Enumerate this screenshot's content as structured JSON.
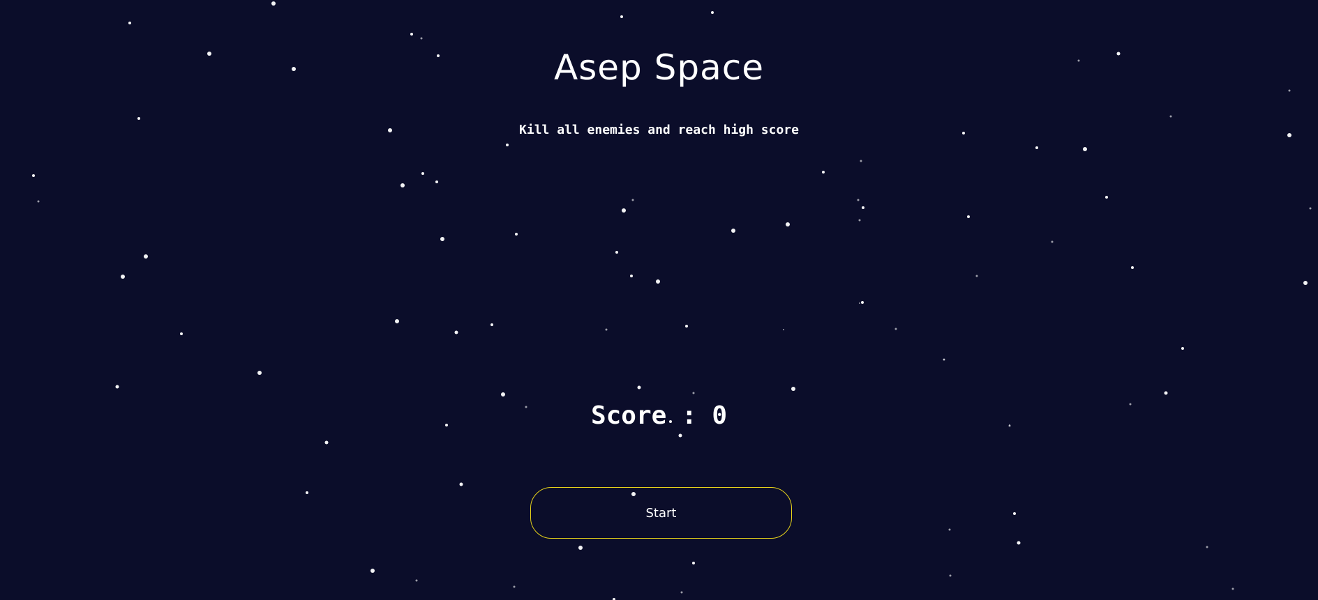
{
  "game": {
    "title": "Asep Space",
    "subtitle": "Kill all enemies and reach high score",
    "score_label": "Score : ",
    "score_value": 0,
    "start_label": "Start"
  },
  "colors": {
    "background": "#0b0d2a",
    "text": "#ffffff",
    "button_border": "#e6d21a",
    "star": "#ffffff"
  }
}
